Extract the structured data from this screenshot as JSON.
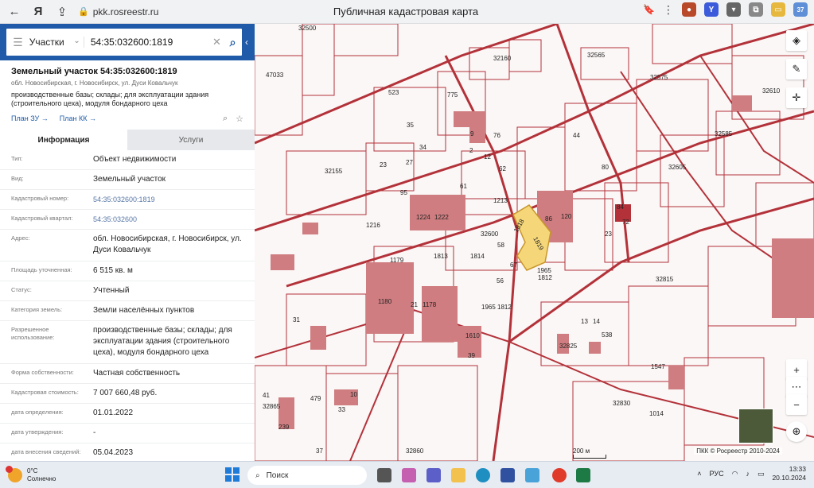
{
  "browser": {
    "url": "pkk.rosreestr.ru",
    "tab_title": "Публичная кадастровая карта",
    "ext_badge": "37"
  },
  "search": {
    "type": "Участки",
    "query": "54:35:032600:1819"
  },
  "object": {
    "title": "Земельный участок 54:35:032600:1819",
    "address": "обл. Новосибирская, г. Новосибирск, ул. Дуси Ковальчук",
    "purpose": "производственные базы; склады; для эксплуатации здания (строительного цеха), модуля бондарного цеха",
    "plan_zu": "План ЗУ",
    "plan_kk": "План КК"
  },
  "tabs": {
    "info": "Информация",
    "services": "Услуги"
  },
  "properties": [
    {
      "key": "Тип:",
      "value": "Объект недвижимости"
    },
    {
      "key": "Вид:",
      "value": "Земельный участок"
    },
    {
      "key": "Кадастровый номер:",
      "value": "54:35:032600:1819"
    },
    {
      "key": "Кадастровый квартал:",
      "value": "54:35:032600"
    },
    {
      "key": "Адрес:",
      "value": "обл. Новосибирская, г. Новосибирск, ул. Дуси Ковальчук"
    },
    {
      "key": "Площадь уточненная:",
      "value": "6 515 кв. м"
    },
    {
      "key": "Статус:",
      "value": "Учтенный"
    },
    {
      "key": "Категория земель:",
      "value": "Земли населённых пунктов"
    },
    {
      "key": "Разрешенное использование:",
      "value": "производственные базы; склады; для эксплуатации здания (строительного цеха), модуля бондарного цеха"
    },
    {
      "key": "Форма собственности:",
      "value": "Частная собственность"
    },
    {
      "key": "Кадастровая стоимость:",
      "value": "7 007 660,48 руб."
    },
    {
      "key": "дата определения:",
      "value": "01.01.2022"
    },
    {
      "key": "дата утверждения:",
      "value": "-"
    },
    {
      "key": "дата внесения сведений:",
      "value": "05.04.2023"
    }
  ],
  "map": {
    "labels": [
      "32500",
      "47033",
      "32160",
      "32565",
      "32575",
      "32610",
      "523",
      "775",
      "35",
      "34",
      "27",
      "23",
      "32155",
      "1216",
      "95",
      "1224",
      "1222",
      "1213",
      "32600",
      "86",
      "120",
      "84",
      "72",
      "23",
      "32605",
      "32585",
      "80",
      "44",
      "62",
      "61",
      "2",
      "76",
      "9",
      "12",
      "1814",
      "58",
      "67",
      "56",
      "1965",
      "1812",
      "1179",
      "1813",
      "1180",
      "1178",
      "21",
      "1610",
      "39",
      "32815",
      "32825",
      "538",
      "1547",
      "32830",
      "1014",
      "32860",
      "32865",
      "479",
      "239",
      "41",
      "31",
      "10",
      "33",
      "37",
      "13",
      "14",
      "1818",
      "1819"
    ],
    "highlight_color": "#f5d77a",
    "line_color": "#b3323a",
    "scale": "200 м",
    "attribution": "ПКК © Росреестр 2010-2024"
  },
  "taskbar": {
    "temperature": "0°C",
    "weather": "Солнечно",
    "search_placeholder": "Поиск",
    "lang": "РУС",
    "time": "13:33",
    "date": "20.10.2024"
  }
}
